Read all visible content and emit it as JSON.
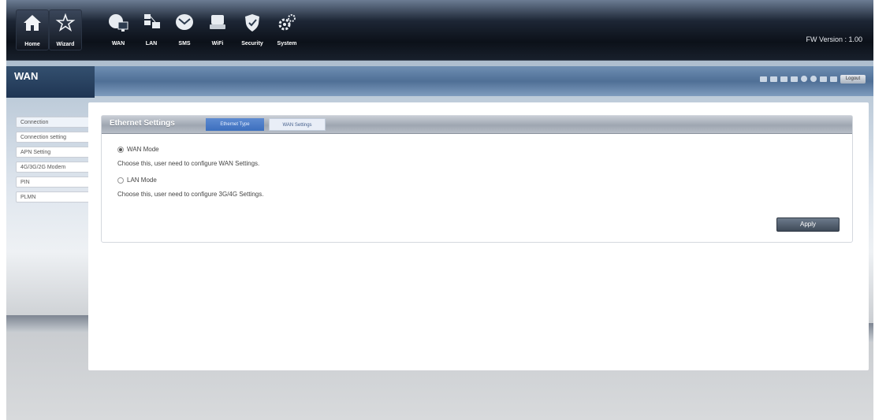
{
  "nav": {
    "items": [
      {
        "label": "Home",
        "icon": "home-icon"
      },
      {
        "label": "Wizard",
        "icon": "wizard-icon"
      },
      {
        "label": "WAN",
        "icon": "wan-icon"
      },
      {
        "label": "LAN",
        "icon": "lan-icon"
      },
      {
        "label": "SMS",
        "icon": "sms-icon"
      },
      {
        "label": "WiFi",
        "icon": "wifi-icon"
      },
      {
        "label": "Security",
        "icon": "security-icon"
      },
      {
        "label": "System",
        "icon": "system-icon"
      }
    ],
    "fw_version": "FW Version : 1.00"
  },
  "page": {
    "title": "WAN",
    "logout_label": "Logout"
  },
  "sidebar": {
    "items": [
      {
        "label": "Connection"
      },
      {
        "label": "Connection setting"
      },
      {
        "label": "APN Setting"
      },
      {
        "label": "4G/3G/2G Modem"
      },
      {
        "label": "PIN"
      },
      {
        "label": "PLMN"
      }
    ]
  },
  "settings": {
    "section_title": "Ethernet Settings",
    "tabs": [
      {
        "label": "Ethernet Type"
      },
      {
        "label": "WAN Settings"
      }
    ],
    "options": [
      {
        "label": "WAN Mode",
        "selected": true,
        "description": "Choose this, user need to configure WAN Settings."
      },
      {
        "label": "LAN Mode",
        "selected": false,
        "description": "Choose this, user need to configure 3G/4G Settings."
      }
    ],
    "apply_label": "Apply"
  },
  "colors": {
    "nav_bg": "#0c1119",
    "title_band": "#4f6f96",
    "active_tab": "#3c6fbe",
    "apply_button": "#3f4a58"
  }
}
